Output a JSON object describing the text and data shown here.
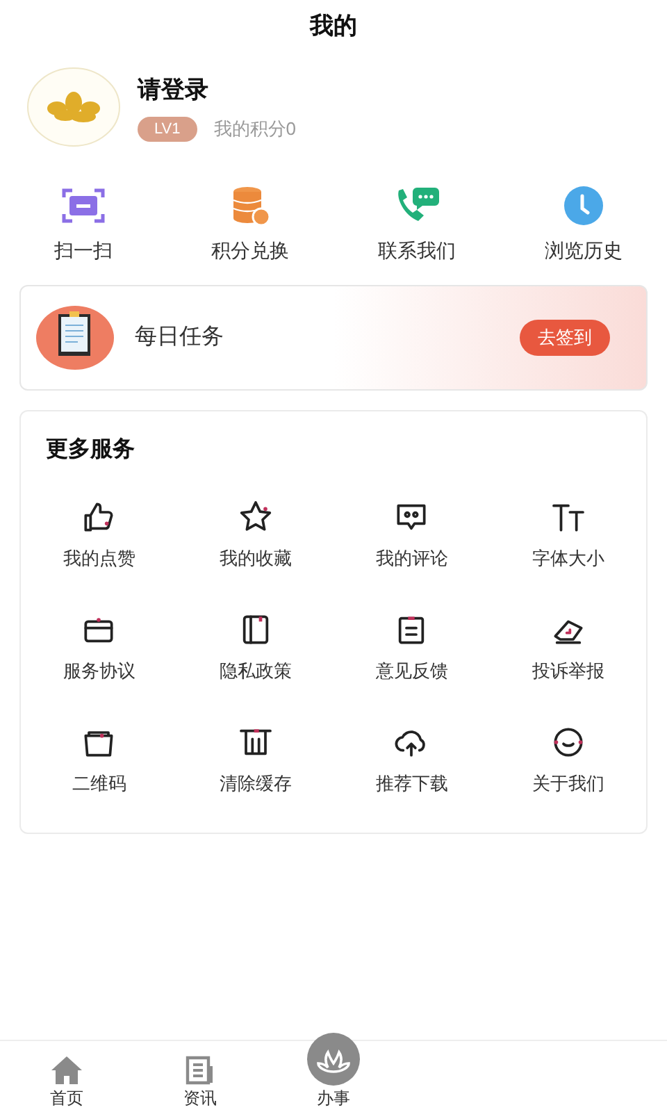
{
  "header": {
    "title": "我的"
  },
  "profile": {
    "name": "请登录",
    "level": "LV1",
    "points": "我的积分0"
  },
  "quick_actions": [
    {
      "label": "扫一扫",
      "kind": "scan"
    },
    {
      "label": "积分兑换",
      "kind": "coins"
    },
    {
      "label": "联系我们",
      "kind": "phone"
    },
    {
      "label": "浏览历史",
      "kind": "clock"
    }
  ],
  "daily_task": {
    "title": "每日任务",
    "button": "去签到"
  },
  "services": {
    "title": "更多服务",
    "items": [
      {
        "label": "我的点赞",
        "kind": "like"
      },
      {
        "label": "我的收藏",
        "kind": "star"
      },
      {
        "label": "我的评论",
        "kind": "comment"
      },
      {
        "label": "字体大小",
        "kind": "font"
      },
      {
        "label": "服务协议",
        "kind": "card"
      },
      {
        "label": "隐私政策",
        "kind": "book"
      },
      {
        "label": "意见反馈",
        "kind": "note"
      },
      {
        "label": "投诉举报",
        "kind": "eraser"
      },
      {
        "label": "二维码",
        "kind": "folder"
      },
      {
        "label": "清除缓存",
        "kind": "trash"
      },
      {
        "label": "推荐下载",
        "kind": "cloud"
      },
      {
        "label": "关于我们",
        "kind": "smile"
      }
    ]
  },
  "tab_bar": [
    {
      "label": "首页",
      "kind": "home",
      "selected": false
    },
    {
      "label": "资讯",
      "kind": "news",
      "selected": false
    },
    {
      "label": "办事",
      "kind": "flower",
      "selected": false
    }
  ]
}
